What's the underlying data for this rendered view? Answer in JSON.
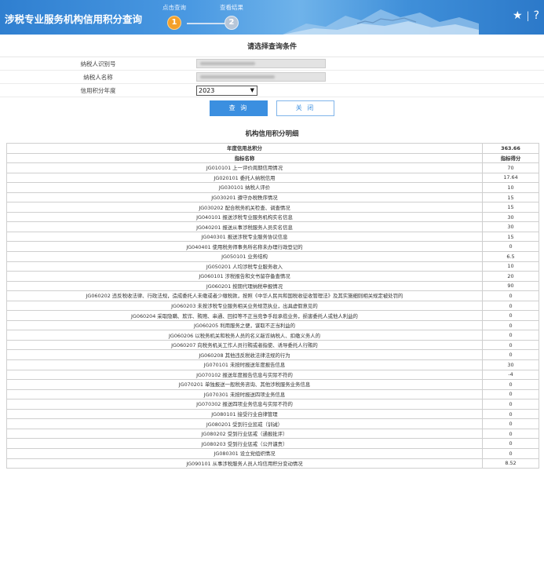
{
  "header": {
    "title": "涉税专业服务机构信用积分查询",
    "steps": [
      {
        "num": "1",
        "label": "点击查询"
      },
      {
        "num": "2",
        "label": "查看结果"
      }
    ],
    "icons": [
      "star-icon",
      "help-icon"
    ],
    "star_glyph": "★",
    "separator": "|",
    "help_glyph": "?"
  },
  "conditions": {
    "title": "请选择查询条件",
    "fields": [
      {
        "label": "纳税人识别号",
        "type": "redacted"
      },
      {
        "label": "纳税人名称",
        "type": "redacted"
      },
      {
        "label": "信用积分年度",
        "type": "select",
        "value": "2023"
      }
    ],
    "query_button": "查 询",
    "close_button": "关 闭"
  },
  "detail": {
    "title": "机构信用积分明细",
    "total_label": "年度信用总积分",
    "total_value": "363.66",
    "col_name": "指标名称",
    "col_score": "指标得分",
    "rows": [
      {
        "name": "JG010101 上一评价周期信用情况",
        "score": "70"
      },
      {
        "name": "JG020101 委托人纳税信用",
        "score": "17.64"
      },
      {
        "name": "JG030101 纳税人评价",
        "score": "10"
      },
      {
        "name": "JG030201 遵守办税秩序情况",
        "score": "15"
      },
      {
        "name": "JG030202 配合税务机关检查、调查情况",
        "score": "15"
      },
      {
        "name": "JG040101 报送涉税专业服务机构实名信息",
        "score": "30"
      },
      {
        "name": "JG040201 报送从事涉税服务人员实名信息",
        "score": "30"
      },
      {
        "name": "JG040301 报送涉税专业服务协议信息",
        "score": "15"
      },
      {
        "name": "JG040401 使用税务师事务所名称未办理行政登记的",
        "score": "0"
      },
      {
        "name": "JG050101 业务结构",
        "score": "6.5"
      },
      {
        "name": "JG050201 人均涉税专业服务收入",
        "score": "10"
      },
      {
        "name": "JG060101 涉税报告和文书留存备查情况",
        "score": "20"
      },
      {
        "name": "JG060201 按期代理纳税申报情况",
        "score": "90"
      },
      {
        "name": "JG060202 违反税收法律、行政法规，造成委托人未缴或者少缴税款，按照《中华人民共和国税收征收管理法》及其实施细则相关规定被处罚的",
        "score": "0"
      },
      {
        "name": "JG060203 未按涉税专业服务相关业务规范执业，出具虚假意见的",
        "score": "0"
      },
      {
        "name": "JG060204 采取隐瞒、欺诈、贿赂、串通、回扣等不正当竞争手段承揽业务，损害委托人或他人利益的",
        "score": "0"
      },
      {
        "name": "JG060205 利用服务之便，谋取不正当利益的",
        "score": "0"
      },
      {
        "name": "JG060206 以税务机关和税务人员的名义敲诈纳税人、扣缴义务人的",
        "score": "0"
      },
      {
        "name": "JG060207 向税务机关工作人员行贿或者指使、诱导委托人行贿的",
        "score": "0"
      },
      {
        "name": "JG060208 其他违反税收法律法规的行为",
        "score": "0"
      },
      {
        "name": "JG070101 未按时报送年度报告信息",
        "score": "30"
      },
      {
        "name": "JG070102 报送年度报告信息与实际不符的",
        "score": "-4"
      },
      {
        "name": "JG070201 单独报送一般税务咨询、其他涉税服务业务信息",
        "score": "0"
      },
      {
        "name": "JG070301 未按时报送四项业务信息",
        "score": "0"
      },
      {
        "name": "JG070302 报送四项业务信息与实际不符的",
        "score": "0"
      },
      {
        "name": "JG080101 接受行业自律管理",
        "score": "0"
      },
      {
        "name": "JG080201 受到行业惩戒（训诫）",
        "score": "0"
      },
      {
        "name": "JG080202 受到行业惩戒（通报批评）",
        "score": "0"
      },
      {
        "name": "JG080203 受到行业惩戒（公开谴责）",
        "score": "0"
      },
      {
        "name": "JG080301 设立党组织情况",
        "score": "0"
      },
      {
        "name": "JG090101 从事涉税服务人员人均信用积分变动情况",
        "score": "8.52"
      }
    ]
  }
}
